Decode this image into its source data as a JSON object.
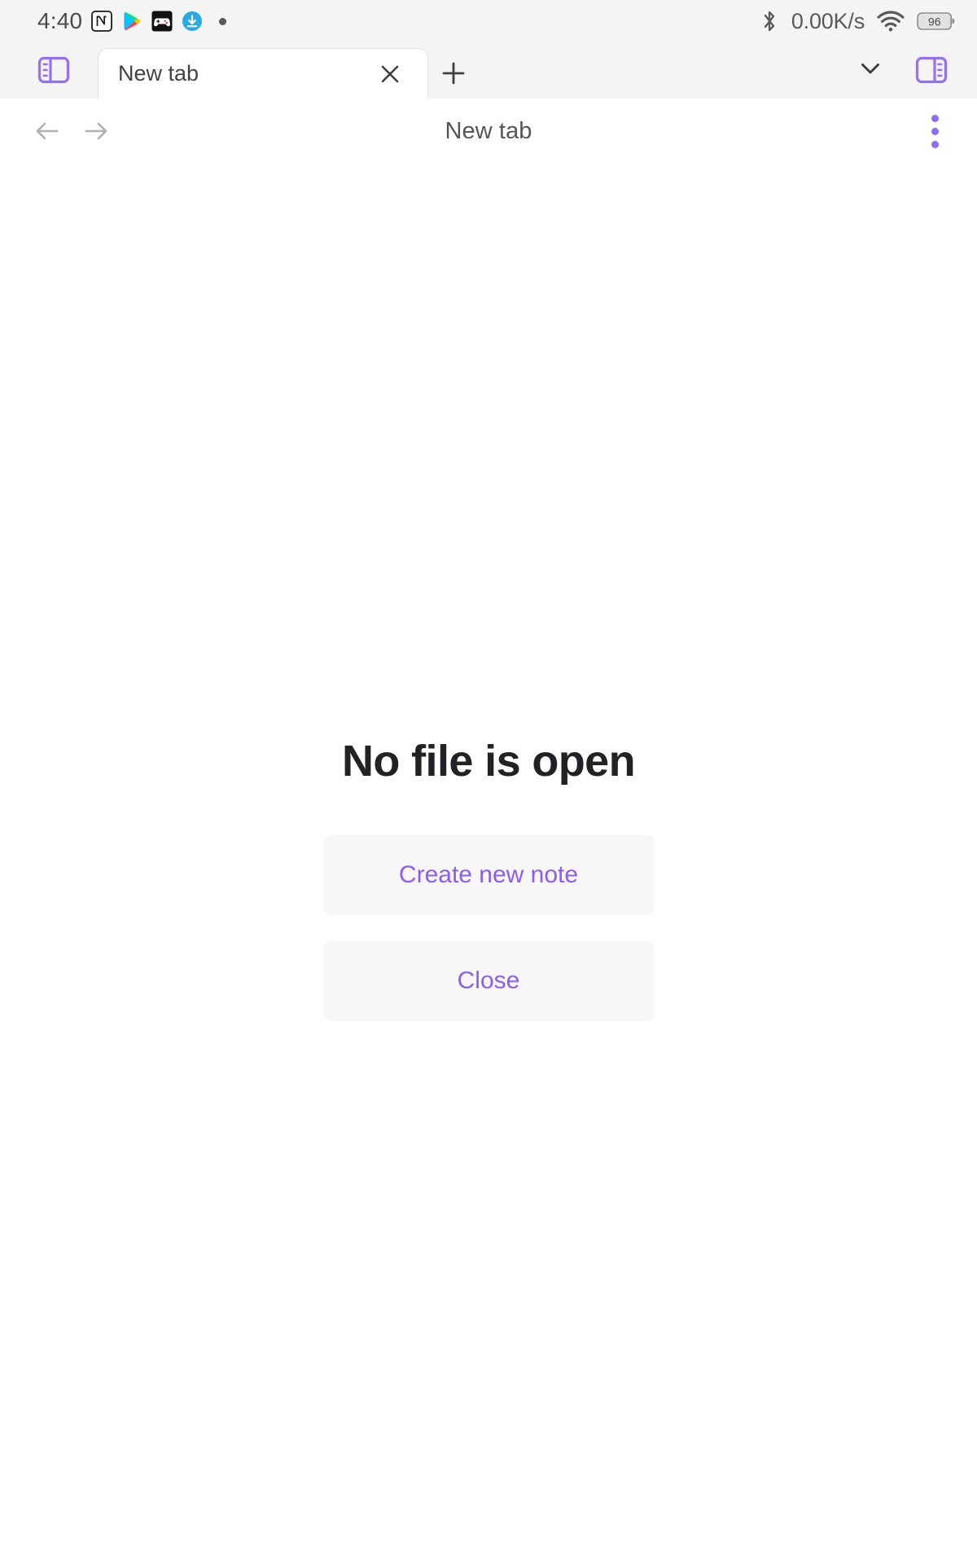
{
  "status_bar": {
    "clock": "4:40",
    "network_speed": "0.00K/s",
    "battery_level": "96",
    "icons": [
      "notion-app-icon",
      "google-play-icon",
      "game-controller-app-icon",
      "download-manager-icon",
      "notification-dot"
    ],
    "right_icons": [
      "bluetooth-icon",
      "wifi-icon",
      "battery-icon"
    ]
  },
  "tab_bar": {
    "left_panel_toggle": "left-sidebar-toggle",
    "right_panel_toggle": "right-sidebar-toggle",
    "tabs": [
      {
        "title": "New tab",
        "active": true
      }
    ],
    "new_tab_label": "+",
    "close_label": "×",
    "chevron_label": "tab-list-dropdown"
  },
  "nav_bar": {
    "back_label": "back",
    "forward_label": "forward",
    "title": "New tab",
    "menu_label": "more-options"
  },
  "content": {
    "empty_title": "No file is open",
    "buttons": [
      {
        "label": "Create new note",
        "name": "create-new-note-button"
      },
      {
        "label": "Close",
        "name": "close-button"
      }
    ]
  },
  "colors": {
    "accent_purple": "#8b5cf6",
    "menu_purple": "#8b6ef0",
    "chrome_gray": "#f4f4f5",
    "button_bg": "#f7f7f8",
    "title_dark": "#222226"
  }
}
